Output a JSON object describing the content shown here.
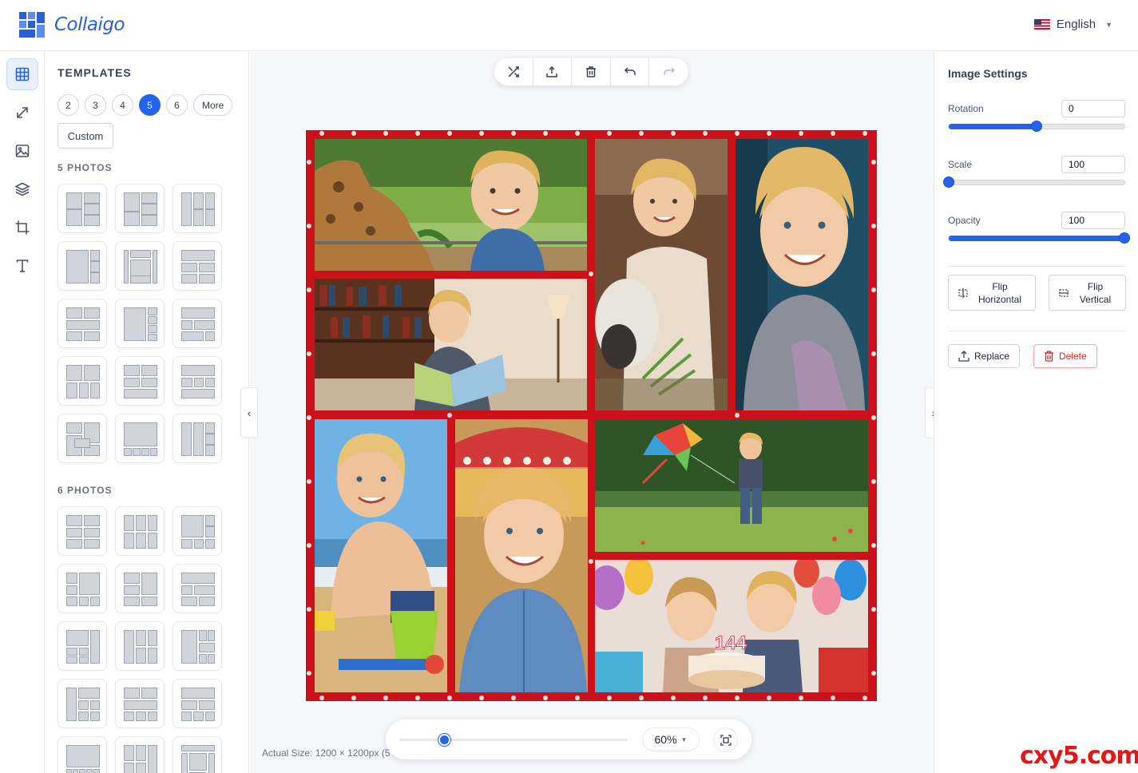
{
  "app": {
    "name": "Collaigo"
  },
  "language": {
    "label": "English"
  },
  "sidebar": {
    "icons": [
      "grid-icon",
      "resize-icon",
      "image-icon",
      "layers-icon",
      "crop-icon",
      "text-icon"
    ]
  },
  "templates": {
    "title": "TEMPLATES",
    "counts": [
      "2",
      "3",
      "4",
      "5",
      "6",
      "More"
    ],
    "selected_count": "5",
    "custom_label": "Custom",
    "section_5": "5 PHOTOS",
    "section_6": "6 PHOTOS"
  },
  "toolbar": {
    "icons": [
      "shuffle-icon",
      "export-icon",
      "trash-icon",
      "undo-icon",
      "redo-icon"
    ]
  },
  "canvas": {
    "frame_color": "#cc111b",
    "photos": [
      "Boy feeding a giraffe at a zoo",
      "Boy feeding a lamb",
      "Smiling boy close-up",
      "Boy reading a book in a library",
      "Boy at the beach with a bucket",
      "Boy in front of a carousel",
      "Boy running with a butterfly kite",
      "Children blowing birthday candles"
    ]
  },
  "zoom": {
    "value": "60%",
    "slider_fraction": 0.2,
    "actual_size": "Actual Size: 1200 × 1200px (5"
  },
  "image_settings": {
    "title": "Image Settings",
    "rotation": {
      "label": "Rotation",
      "value": "0",
      "fraction": 0.5
    },
    "scale": {
      "label": "Scale",
      "value": "100",
      "fraction": 0.0
    },
    "opacity": {
      "label": "Opacity",
      "value": "100",
      "fraction": 1.0
    },
    "flip_horizontal": "Flip Horizontal",
    "flip_vertical": "Flip Vertical",
    "replace": "Replace",
    "delete": "Delete"
  },
  "watermark": "cxy5.com",
  "colors": {
    "accent": "#2563eb",
    "danger": "#dc2626"
  }
}
